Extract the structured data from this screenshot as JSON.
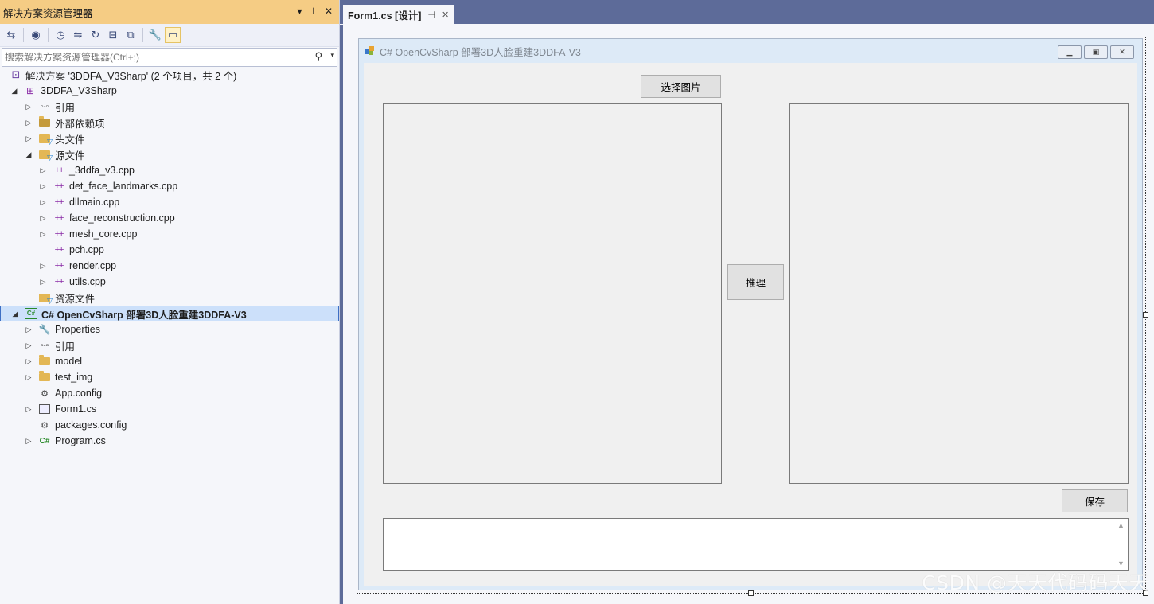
{
  "solution_explorer": {
    "title": "解决方案资源管理器",
    "title_controls": [
      "▾",
      "⊥",
      "✕"
    ],
    "search_placeholder": "搜索解决方案资源管理器(Ctrl+;)",
    "tree": [
      {
        "label": "解决方案 '3DDFA_V3Sharp' (2 个项目，共 2 个)",
        "icon": "solution-icon",
        "expand": "",
        "level": 0
      },
      {
        "label": "3DDFA_V3Sharp",
        "icon": "cpp-project-icon",
        "expand": "◢",
        "level": 1
      },
      {
        "label": "引用",
        "icon": "references-icon",
        "expand": "▷",
        "level": 2
      },
      {
        "label": "外部依赖项",
        "icon": "external-deps-icon",
        "expand": "▷",
        "level": 2
      },
      {
        "label": "头文件",
        "icon": "filter-folder-icon",
        "expand": "▷",
        "level": 2
      },
      {
        "label": "源文件",
        "icon": "filter-folder-icon",
        "expand": "◢",
        "level": 2
      },
      {
        "label": "_3ddfa_v3.cpp",
        "icon": "cpp-file-icon",
        "expand": "▷",
        "level": 3
      },
      {
        "label": "det_face_landmarks.cpp",
        "icon": "cpp-file-icon",
        "expand": "▷",
        "level": 3
      },
      {
        "label": "dllmain.cpp",
        "icon": "cpp-file-icon",
        "expand": "▷",
        "level": 3
      },
      {
        "label": "face_reconstruction.cpp",
        "icon": "cpp-file-icon",
        "expand": "▷",
        "level": 3
      },
      {
        "label": "mesh_core.cpp",
        "icon": "cpp-file-icon",
        "expand": "▷",
        "level": 3
      },
      {
        "label": "pch.cpp",
        "icon": "cpp-file-icon",
        "expand": "",
        "level": 3
      },
      {
        "label": "render.cpp",
        "icon": "cpp-file-icon",
        "expand": "▷",
        "level": 3
      },
      {
        "label": "utils.cpp",
        "icon": "cpp-file-icon",
        "expand": "▷",
        "level": 3
      },
      {
        "label": "资源文件",
        "icon": "filter-folder-icon",
        "expand": "",
        "level": 2
      },
      {
        "label": "C# OpenCvSharp 部署3D人脸重建3DDFA-V3",
        "icon": "csharp-project-icon",
        "expand": "◢",
        "level": 1,
        "selected": true
      },
      {
        "label": "Properties",
        "icon": "wrench-icon",
        "expand": "▷",
        "level": 2
      },
      {
        "label": "引用",
        "icon": "references-icon",
        "expand": "▷",
        "level": 2
      },
      {
        "label": "model",
        "icon": "folder-icon",
        "expand": "▷",
        "level": 2
      },
      {
        "label": "test_img",
        "icon": "folder-icon",
        "expand": "▷",
        "level": 2
      },
      {
        "label": "App.config",
        "icon": "config-file-icon",
        "expand": "",
        "level": 2
      },
      {
        "label": "Form1.cs",
        "icon": "form-file-icon",
        "expand": "▷",
        "level": 2
      },
      {
        "label": "packages.config",
        "icon": "config-file-icon",
        "expand": "",
        "level": 2
      },
      {
        "label": "Program.cs",
        "icon": "csharp-file-icon",
        "expand": "▷",
        "level": 2
      }
    ]
  },
  "designer": {
    "tab_label": "Form1.cs [设计]",
    "form_title": "C# OpenCvSharp 部署3D人脸重建3DDFA-V3",
    "select_button": "选择图片",
    "infer_button": "推理",
    "save_button": "保存",
    "output_text": ""
  },
  "watermark": "CSDN @天天代码码天天"
}
